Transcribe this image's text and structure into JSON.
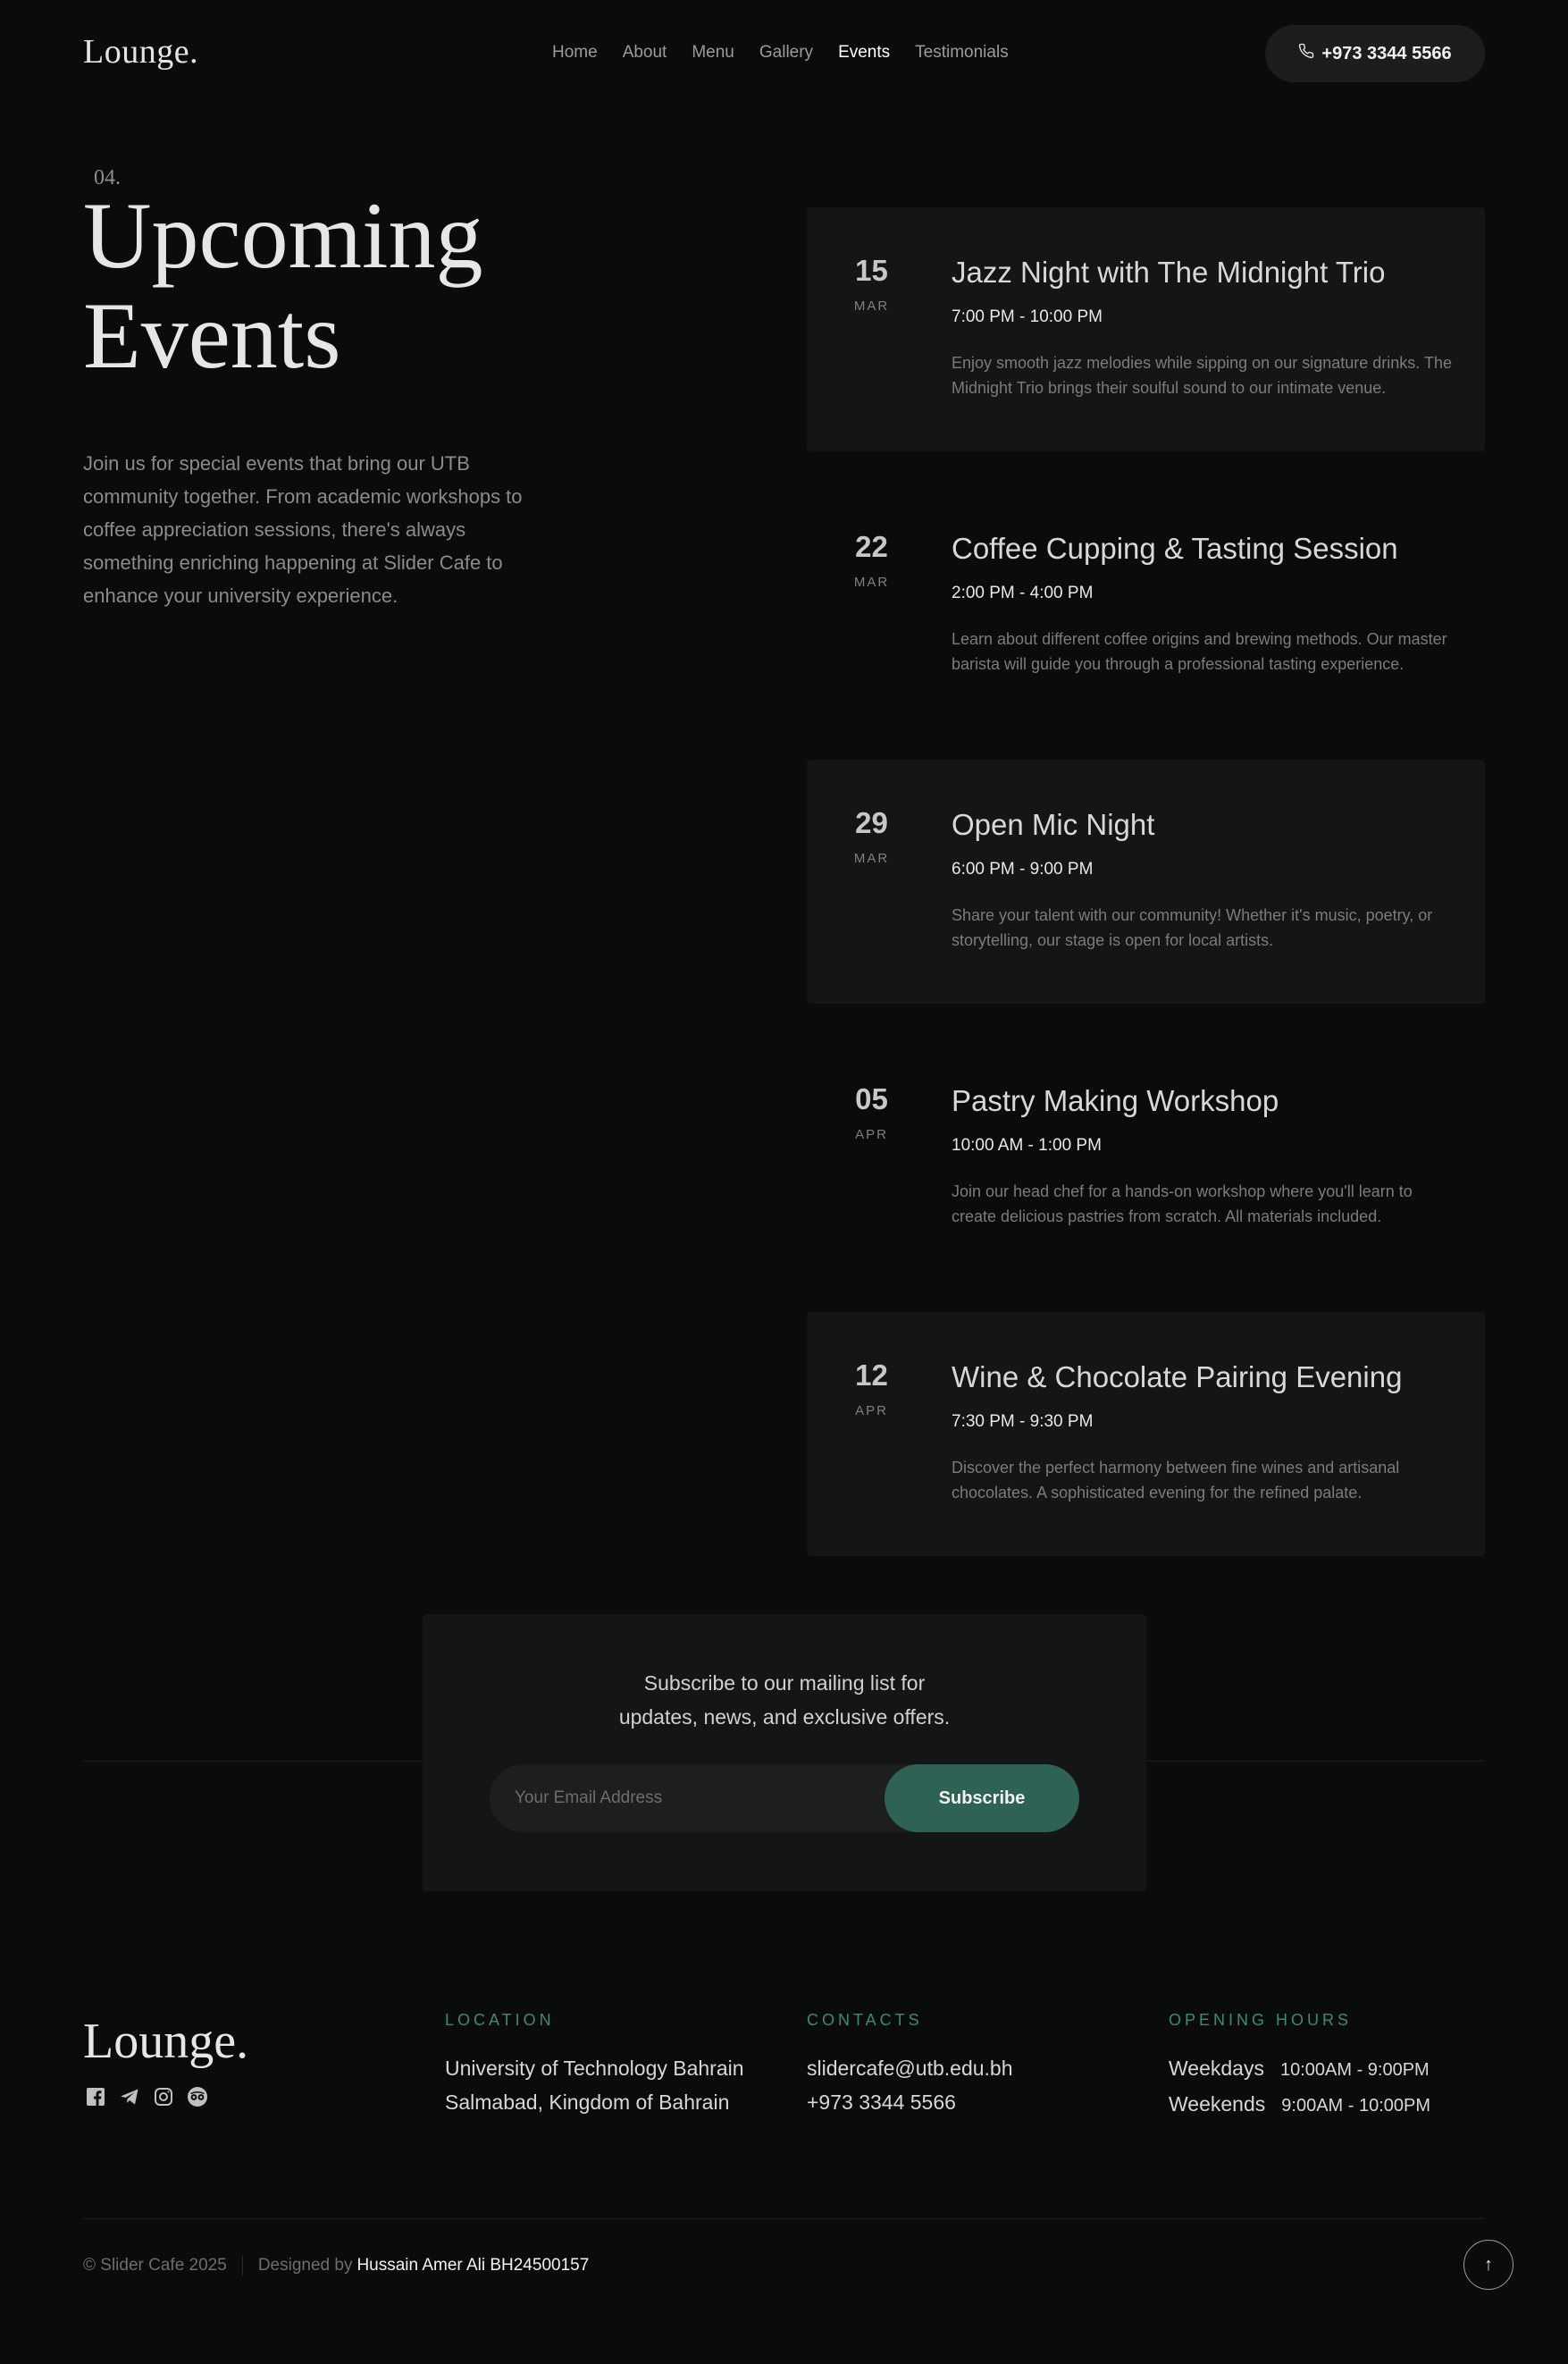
{
  "header": {
    "logo": "Lounge.",
    "nav": [
      "Home",
      "About",
      "Menu",
      "Gallery",
      "Events",
      "Testimonials"
    ],
    "active_nav": "Events",
    "phone": "+973 3344 5566",
    "phone_icon": "phone-icon"
  },
  "hero": {
    "section_number": "04.",
    "title_line1": "Upcoming",
    "title_line2": "Events",
    "description": "Join us for special events that bring our UTB community together. From academic workshops to coffee appreciation sessions, there's always something enriching happening at Slider Cafe to enhance your university experience."
  },
  "events": [
    {
      "day": "15",
      "month": "MAR",
      "title": "Jazz Night with The Midnight Trio",
      "time": "7:00 PM - 10:00 PM",
      "description": "Enjoy smooth jazz melodies while sipping on our signature drinks. The Midnight Trio brings their soulful sound to our intimate venue."
    },
    {
      "day": "22",
      "month": "MAR",
      "title": "Coffee Cupping & Tasting Session",
      "time": "2:00 PM - 4:00 PM",
      "description": "Learn about different coffee origins and brewing methods. Our master barista will guide you through a professional tasting experience."
    },
    {
      "day": "29",
      "month": "MAR",
      "title": "Open Mic Night",
      "time": "6:00 PM - 9:00 PM",
      "description": "Share your talent with our community! Whether it's music, poetry, or storytelling, our stage is open for local artists."
    },
    {
      "day": "05",
      "month": "APR",
      "title": "Pastry Making Workshop",
      "time": "10:00 AM - 1:00 PM",
      "description": "Join our head chef for a hands-on workshop where you'll learn to create delicious pastries from scratch. All materials included."
    },
    {
      "day": "12",
      "month": "APR",
      "title": "Wine & Chocolate Pairing Evening",
      "time": "7:30 PM - 9:30 PM",
      "description": "Discover the perfect harmony between fine wines and artisanal chocolates. A sophisticated evening for the refined palate."
    }
  ],
  "subscribe": {
    "text_line1": "Subscribe to our mailing list for",
    "text_line2": "updates, news, and exclusive offers.",
    "placeholder": "Your Email Address",
    "button": "Subscribe"
  },
  "footer": {
    "logo": "Lounge.",
    "social_icons": [
      "facebook-icon",
      "telegram-icon",
      "instagram-icon",
      "tripadvisor-icon"
    ],
    "location": {
      "heading": "LOCATION",
      "line1": "University of Technology Bahrain",
      "line2": "Salmabad, Kingdom of Bahrain"
    },
    "contacts": {
      "heading": "CONTACTS",
      "email": "slidercafe@utb.edu.bh",
      "phone": "+973 3344 5566"
    },
    "hours": {
      "heading": "OPENING HOURS",
      "rows": [
        {
          "label": "Weekdays",
          "hours": "10:00AM - 9:00PM"
        },
        {
          "label": "Weekends",
          "hours": "9:00AM - 10:00PM"
        }
      ]
    },
    "copyright": "© Slider Cafe 2025",
    "designed_by_label": "Designed by",
    "designer": "Hussain Amer Ali BH24500157",
    "back_to_top_icon": "arrow-up-icon",
    "back_to_top_glyph": "↑"
  },
  "colors": {
    "background": "#0a0c0b",
    "card": "#141615",
    "accent": "#2e6254",
    "accent_text": "#3e8a73"
  }
}
